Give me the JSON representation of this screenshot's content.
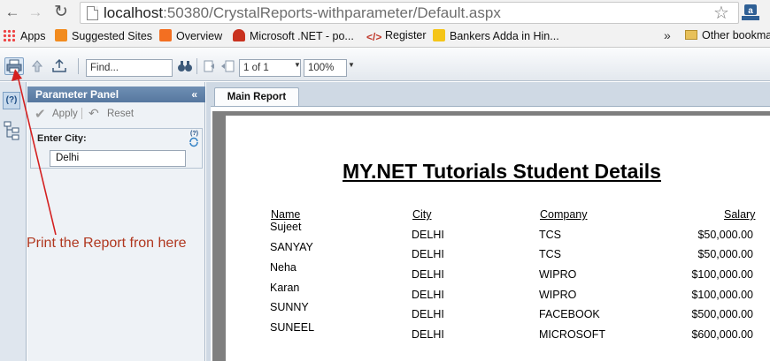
{
  "browser": {
    "url_host": "localhost",
    "url_path": ":50380/CrystalReports-withparameter/Default.aspx"
  },
  "bookmarks": [
    {
      "label": "Apps",
      "icon": "apps-grid-icon"
    },
    {
      "label": "Suggested Sites",
      "icon": "suggested-sites-icon"
    },
    {
      "label": "Overview",
      "icon": "blogger-icon"
    },
    {
      "label": "Microsoft .NET - po...",
      "icon": "flame-icon"
    },
    {
      "label": "Register",
      "icon": "code-icon"
    },
    {
      "label": "Bankers Adda in Hin...",
      "icon": "bankers-adda-icon"
    }
  ],
  "bookmarks_more": "»",
  "bookmarks_other": "Other bookma",
  "toolbar": {
    "find_placeholder": "Find...",
    "page_value": "1 of 1",
    "zoom_value": "100%"
  },
  "parameter_panel": {
    "title": "Parameter Panel",
    "collapse_label": "«",
    "apply_label": "Apply",
    "reset_label": "Reset",
    "param_label": "Enter City:",
    "param_value": "Delhi",
    "help_badge": "(?)"
  },
  "report_tab": "Main Report",
  "report": {
    "title": "MY.NET Tutorials Student Details",
    "columns": [
      "Name",
      "City",
      "Company",
      "Salary"
    ],
    "rows": [
      {
        "name": "Sujeet",
        "city": "DELHI",
        "company": "TCS",
        "salary": "$50,000.00"
      },
      {
        "name": "SANYAY",
        "city": "DELHI",
        "company": "TCS",
        "salary": "$50,000.00"
      },
      {
        "name": "Neha",
        "city": "DELHI",
        "company": "WIPRO",
        "salary": "$100,000.00"
      },
      {
        "name": "Karan",
        "city": "DELHI",
        "company": "WIPRO",
        "salary": "$100,000.00"
      },
      {
        "name": "SUNNY",
        "city": "DELHI",
        "company": "FACEBOOK",
        "salary": "$500,000.00"
      },
      {
        "name": "SUNEEL",
        "city": "DELHI",
        "company": "MICROSOFT",
        "salary": "$600,000.00"
      }
    ]
  },
  "annotation": "Print the Report fron here",
  "colors": {
    "annotation": "#b0371f",
    "panel_header": "#5f80a8"
  }
}
